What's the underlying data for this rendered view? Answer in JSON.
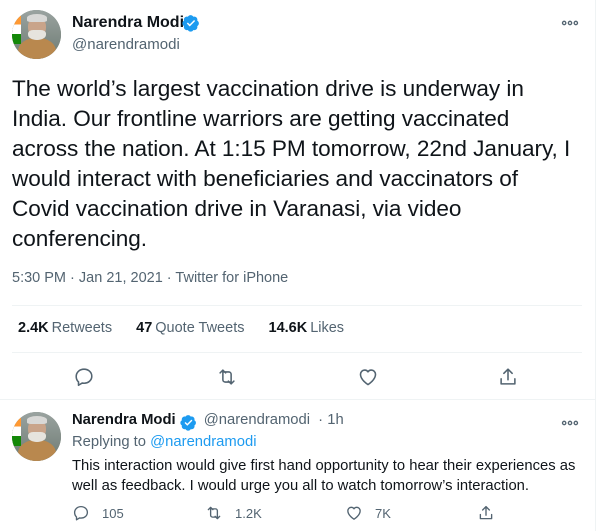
{
  "tweet": {
    "author_name": "Narendra Modi",
    "author_handle": "@narendramodi",
    "text": "The world’s largest vaccination drive is underway in India. Our frontline warriors are getting vaccinated across the nation. At 1:15 PM tomorrow, 22nd January, I would interact with beneficiaries and vaccinators of Covid vaccination drive in Varanasi, via video conferencing.",
    "time": "5:30 PM",
    "date": "Jan 21, 2021",
    "source": "Twitter for iPhone",
    "separator": "·",
    "stats": {
      "retweets_count": "2.4K",
      "retweets_label": "Retweets",
      "quotes_count": "47",
      "quotes_label": "Quote Tweets",
      "likes_count": "14.6K",
      "likes_label": "Likes"
    },
    "icons": [
      "reply-icon",
      "retweet-icon",
      "like-icon",
      "share-icon",
      "more-icon",
      "verified-icon"
    ]
  },
  "reply": {
    "author_name": "Narendra Modi",
    "author_handle": "@narendramodi",
    "age": "· 1h",
    "replying_prefix": "Replying to",
    "replying_to": "@narendramodi",
    "text": "This interaction would give first hand opportunity to hear their experiences as well as feedback. I would urge you all to watch tomorrow’s interaction.",
    "reply_count": "105",
    "retweet_count": "1.2K",
    "like_count": "7K"
  },
  "colors": {
    "accent": "#1d9bf0",
    "text_primary": "#0f1419",
    "text_secondary": "#536471",
    "divider": "#eff3f4"
  }
}
